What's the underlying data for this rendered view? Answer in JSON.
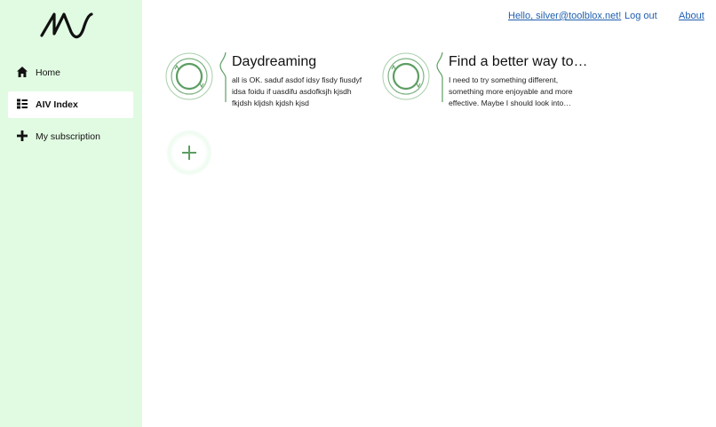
{
  "nav": {
    "items": [
      {
        "label": "Home",
        "icon": "home-icon",
        "active": false
      },
      {
        "label": "AIV Index",
        "icon": "list-icon",
        "active": true
      },
      {
        "label": "My subscription",
        "icon": "plus-icon",
        "active": false
      }
    ]
  },
  "header": {
    "user_link": "Hello, silver@toolblox.net!",
    "logout": "Log out",
    "about": "About"
  },
  "cards": [
    {
      "title": "Daydreaming",
      "description": "all is OK. saduf asdof idsy fisdy fiusdyf idsa foidu if uasdifu asdofksjh kjsdh fkjdsh kljdsh kjdsh kjsd"
    },
    {
      "title": "Find a better way to …",
      "description": "I need to try something different, something more enjoyable and more effective. Maybe I should look into…"
    }
  ],
  "colors": {
    "sidebar_bg": "#e1fbe2",
    "accent_green": "#5d9e63",
    "link_blue": "#1f5fae"
  },
  "icons": {
    "logo": "aiv-logo",
    "add": "add-plus-icon"
  }
}
